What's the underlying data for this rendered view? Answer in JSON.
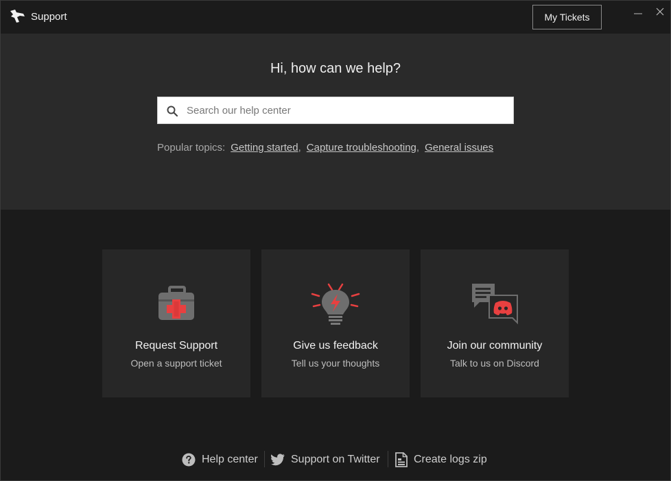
{
  "app": {
    "title": "Support"
  },
  "header": {
    "my_tickets_label": "My Tickets"
  },
  "hero": {
    "title": "Hi, how can we help?",
    "search_placeholder": "Search our help center",
    "popular_label": "Popular topics:",
    "topics": [
      "Getting started",
      "Capture troubleshooting",
      "General issues"
    ]
  },
  "cards": [
    {
      "title": "Request Support",
      "subtitle": "Open a support ticket",
      "icon": "first-aid-kit-icon"
    },
    {
      "title": "Give us feedback",
      "subtitle": "Tell us your thoughts",
      "icon": "lightbulb-icon"
    },
    {
      "title": "Join our community",
      "subtitle": "Talk to us on Discord",
      "icon": "discord-chat-icon"
    }
  ],
  "footer": {
    "links": [
      {
        "label": "Help center",
        "icon": "question-circle-icon"
      },
      {
        "label": "Support on Twitter",
        "icon": "twitter-icon"
      },
      {
        "label": "Create logs zip",
        "icon": "document-icon"
      }
    ]
  },
  "colors": {
    "accent": "#e84040",
    "background": "#1b1b1b",
    "panel": "#2a2a2a",
    "card": "#272727"
  }
}
